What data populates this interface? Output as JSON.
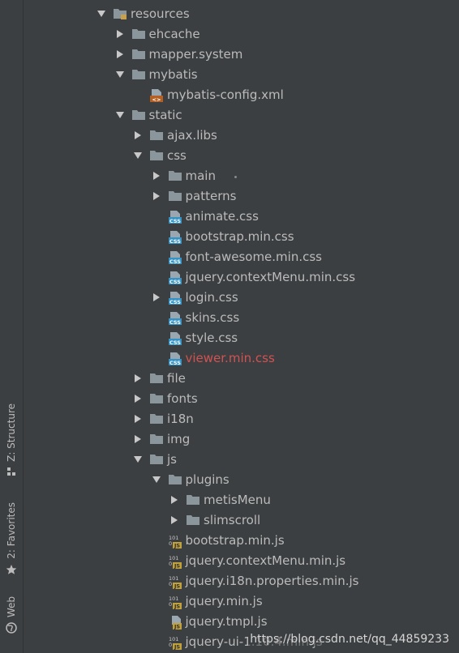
{
  "sidebar": {
    "tabs": [
      {
        "label": "Z: Structure",
        "icon": "structure-icon"
      },
      {
        "label": "2: Favorites",
        "icon": "star-icon"
      },
      {
        "label": "Web",
        "icon": "globe-icon"
      }
    ]
  },
  "tree": [
    {
      "label": "resources",
      "depth": 0,
      "kind": "folder-res",
      "arrow": "down"
    },
    {
      "label": "ehcache",
      "depth": 1,
      "kind": "folder",
      "arrow": "right"
    },
    {
      "label": "mapper.system",
      "depth": 1,
      "kind": "folder",
      "arrow": "right"
    },
    {
      "label": "mybatis",
      "depth": 1,
      "kind": "folder",
      "arrow": "down"
    },
    {
      "label": "mybatis-config.xml",
      "depth": 2,
      "kind": "xml",
      "arrow": "none"
    },
    {
      "label": "static",
      "depth": 1,
      "kind": "folder",
      "arrow": "down"
    },
    {
      "label": "ajax.libs",
      "depth": 2,
      "kind": "folder",
      "arrow": "right"
    },
    {
      "label": "css",
      "depth": 2,
      "kind": "folder",
      "arrow": "down"
    },
    {
      "label": "main",
      "depth": 3,
      "kind": "folder",
      "arrow": "right"
    },
    {
      "label": "patterns",
      "depth": 3,
      "kind": "folder",
      "arrow": "right"
    },
    {
      "label": "animate.css",
      "depth": 3,
      "kind": "css",
      "arrow": "none"
    },
    {
      "label": "bootstrap.min.css",
      "depth": 3,
      "kind": "css",
      "arrow": "none"
    },
    {
      "label": "font-awesome.min.css",
      "depth": 3,
      "kind": "css",
      "arrow": "none"
    },
    {
      "label": "jquery.contextMenu.min.css",
      "depth": 3,
      "kind": "css",
      "arrow": "none"
    },
    {
      "label": "login.css",
      "depth": 3,
      "kind": "css",
      "arrow": "right"
    },
    {
      "label": "skins.css",
      "depth": 3,
      "kind": "css",
      "arrow": "none"
    },
    {
      "label": "style.css",
      "depth": 3,
      "kind": "css",
      "arrow": "none"
    },
    {
      "label": "viewer.min.css",
      "depth": 3,
      "kind": "css",
      "arrow": "none",
      "error": true
    },
    {
      "label": "file",
      "depth": 2,
      "kind": "folder",
      "arrow": "right"
    },
    {
      "label": "fonts",
      "depth": 2,
      "kind": "folder",
      "arrow": "right"
    },
    {
      "label": "i18n",
      "depth": 2,
      "kind": "folder",
      "arrow": "right"
    },
    {
      "label": "img",
      "depth": 2,
      "kind": "folder",
      "arrow": "right"
    },
    {
      "label": "js",
      "depth": 2,
      "kind": "folder",
      "arrow": "down"
    },
    {
      "label": "plugins",
      "depth": 3,
      "kind": "folder",
      "arrow": "down"
    },
    {
      "label": "metisMenu",
      "depth": 4,
      "kind": "folder",
      "arrow": "right"
    },
    {
      "label": "slimscroll",
      "depth": 4,
      "kind": "folder",
      "arrow": "right"
    },
    {
      "label": "bootstrap.min.js",
      "depth": 3,
      "kind": "jsbin",
      "arrow": "none"
    },
    {
      "label": "jquery.contextMenu.min.js",
      "depth": 3,
      "kind": "jsbin",
      "arrow": "none"
    },
    {
      "label": "jquery.i18n.properties.min.js",
      "depth": 3,
      "kind": "jsbin",
      "arrow": "none"
    },
    {
      "label": "jquery.min.js",
      "depth": 3,
      "kind": "jsbin",
      "arrow": "none"
    },
    {
      "label": "jquery.tmpl.js",
      "depth": 3,
      "kind": "js",
      "arrow": "none"
    },
    {
      "label": "jquery-ui-1.10.4.min.js",
      "depth": 3,
      "kind": "jsbin",
      "arrow": "none"
    }
  ],
  "watermark": "https://blog.csdn.net/qq_44859233",
  "colors": {
    "background": "#3c3f41",
    "text": "#bbbbbb",
    "error_text": "#d25252",
    "folder": "#8b959c",
    "css_badge": "#3592c4",
    "js_badge": "#c1a13c",
    "xml_badge": "#b45f24"
  }
}
